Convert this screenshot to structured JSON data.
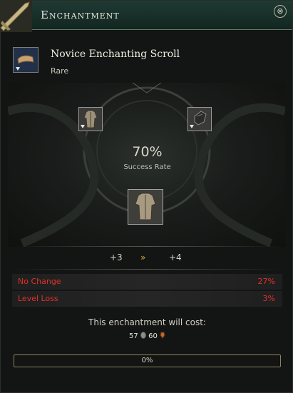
{
  "window": {
    "title": "Enchantment",
    "close_label": "⊗"
  },
  "item": {
    "name": "Novice Enchanting Scroll",
    "rarity": "Rare"
  },
  "enchant": {
    "success_rate": "70%",
    "success_label": "Success Rate",
    "from_level": "+3",
    "arrow": "»",
    "to_level": "+4"
  },
  "outcomes": [
    {
      "label": "No Change",
      "value": "27%"
    },
    {
      "label": "Level Loss",
      "value": "3%"
    }
  ],
  "cost": {
    "label": "This enchantment will cost:",
    "amount_a": "57",
    "amount_b": "60"
  },
  "progress": {
    "text": "0%",
    "fraction": 0
  },
  "colors": {
    "accent_red": "#e0322a",
    "title_bar": "#1f3a33"
  },
  "icons": [
    "scroll-icon",
    "armor-icon",
    "gauntlet-icon",
    "silver-coin-icon",
    "copper-coin-icon",
    "close-icon",
    "double-chevron-icon"
  ]
}
